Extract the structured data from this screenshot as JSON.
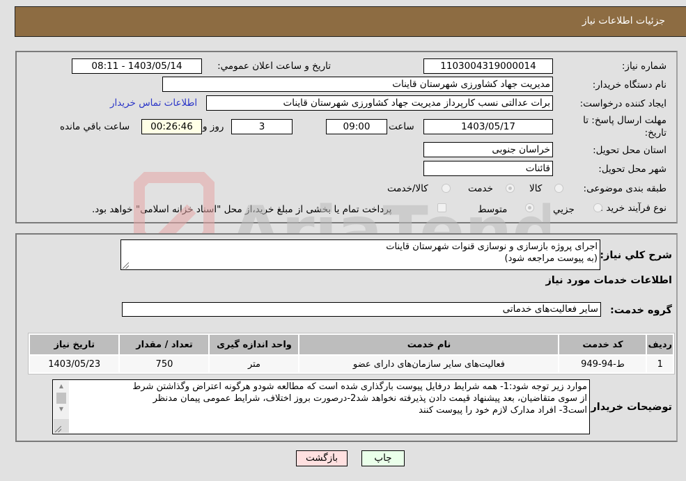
{
  "header": {
    "title": "جزئیات اطلاعات نیاز"
  },
  "details": {
    "need_number_label": "شماره نیاز:",
    "need_number": "1103004319000014",
    "announce_label": "تاریخ و ساعت اعلان عمومي:",
    "announce_value": "1403/05/14 - 08:11",
    "buyer_org_label": "نام دستگاه خریدار:",
    "buyer_org": "مدیریت جهاد کشاورزی شهرستان قاینات",
    "requester_label": "ایجاد کننده درخواست:",
    "requester": "برات عدالتی نسب کارپرداز مدیریت جهاد کشاورزی شهرستان قاینات",
    "contact_link": "اطلاعات تماس خریدار",
    "deadline_label_1": "مهلت ارسال پاسخ: تا",
    "deadline_label_2": "تاریخ:",
    "deadline_date": "1403/05/17",
    "time_label": "ساعت",
    "deadline_time": "09:00",
    "days_value": "3",
    "days_label": "روز و",
    "remaining_value": "00:26:46",
    "remaining_label": "ساعت باقي مانده",
    "province_label": "استان محل تحویل:",
    "province": "خراسان جنوبی",
    "city_label": "شهر محل تحویل:",
    "city": "قائنات",
    "category_label": "طبقه بندی موضوعی:",
    "category_options": [
      {
        "label": "کالا",
        "checked": false
      },
      {
        "label": "خدمت",
        "checked": true
      },
      {
        "label": "کالا/خدمت",
        "checked": false
      }
    ],
    "process_label": "نوع فرآیند خرید :",
    "process_options": [
      {
        "label": "جزيي",
        "checked": false
      },
      {
        "label": "متوسط",
        "checked": true
      }
    ],
    "treasury_note": "پرداخت تمام یا بخشی از مبلغ خرید،از محل \"اسناد خزانه اسلامی\" خواهد بود."
  },
  "description": {
    "label": "شرح كلي نياز:",
    "line1": "اجرای پروژه بازسازی و نوسازی قنوات شهرستان قاینات",
    "line2": "(به پیوست مراجعه شود)"
  },
  "services": {
    "section_title": "اطلاعات خدمات مورد نیاز",
    "group_label": "گروه خدمت:",
    "group_value": "سایر فعالیت‌های خدماتی",
    "columns": [
      "ردیف",
      "کد خدمت",
      "نام خدمت",
      "واحد اندازه گیری",
      "تعداد / مقدار",
      "تاریخ نیاز"
    ],
    "rows": [
      {
        "index": "1",
        "code": "ط-94-949",
        "name": "فعالیت‌های سایر سازمان‌های دارای عضو",
        "unit": "متر",
        "quantity": "750",
        "date": "1403/05/23"
      }
    ]
  },
  "buyer_notes": {
    "label": "توضیحات خریدار:",
    "line1": "موارد زیر توجه شود:1- همه شرایط درفایل پیوست بارگذاری شده است که مطالعه شودو هرگونه اعتراض وگذاشتن شرط",
    "line2": "از سوی متقاضیان، بعد پیشنهاد قیمت دادن پذیرفته نخواهد شد2-درصورت بروز اختلاف، شرایط عمومی پیمان مدنظر",
    "line3": "است3- افراد مدارک لازم خود را پیوست کنند"
  },
  "buttons": {
    "print": "چاپ",
    "back": "بازگشت"
  },
  "watermark": {
    "text": "AriaTender.neT"
  },
  "colors": {
    "header_bg": "#8d6c42",
    "link": "#2a35c7",
    "print_bg": "#eaffea",
    "back_bg": "#ffe0e0",
    "remaining_bg": "#ffffe6"
  }
}
